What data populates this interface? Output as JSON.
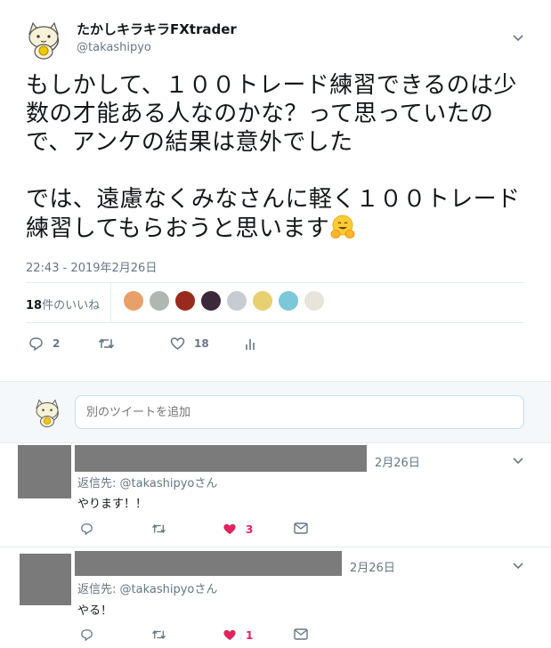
{
  "tweet": {
    "display_name": "たかしキラキラFXtrader",
    "username": "@takashipyo",
    "text": "もしかして、１００トレード練習できるのは少数の才能ある人なのかな？って思っていたので、アンケの結果は意外でした\n\nでは、遠慮なくみなさんに軽く１００トレード練習してもらおうと思います",
    "emoji": "hugging-face",
    "timestamp": "22:43 - 2019年2月26日",
    "likes_count": "18",
    "likes_label": "件のいいね",
    "likers": [
      {
        "color": "#e8a06a"
      },
      {
        "color": "#b0b6b0"
      },
      {
        "color": "#9b2a1e"
      },
      {
        "color": "#3a2a3a"
      },
      {
        "color": "#c7ccd2"
      },
      {
        "color": "#e8d070"
      },
      {
        "color": "#7cc8d8"
      },
      {
        "color": "#e8e4dc"
      }
    ],
    "reply_count": "2",
    "retweet_count": "",
    "like_count": "18"
  },
  "compose": {
    "placeholder": "別のツイートを追加"
  },
  "replies": [
    {
      "date": "2月26日",
      "reply_to_label": "返信先: ",
      "reply_to_handle": "@takashipyo",
      "reply_to_suffix": "さん",
      "text": "やります！！",
      "like_count": "3"
    },
    {
      "date": "2月26日",
      "reply_to_label": "返信先: ",
      "reply_to_handle": "@takashipyo",
      "reply_to_suffix": "さん",
      "text": "やる！",
      "like_count": "1"
    }
  ],
  "colors": {
    "liked": "#e0245e",
    "muted": "#657786",
    "redaction": "#7b7b7b"
  }
}
